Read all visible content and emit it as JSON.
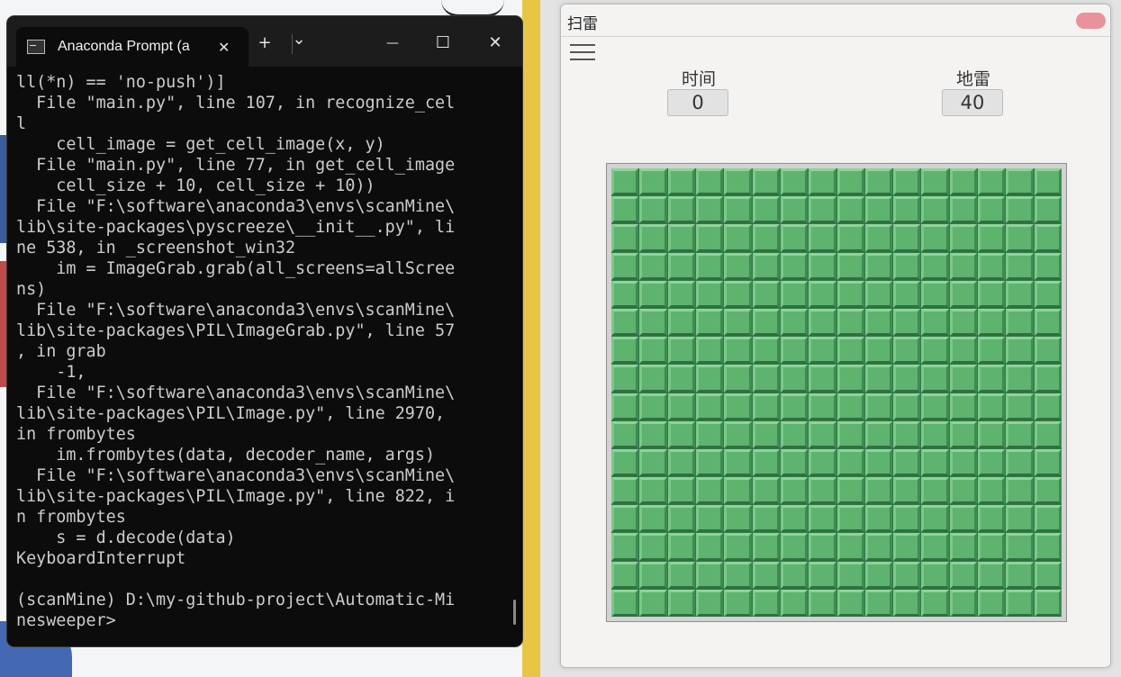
{
  "terminal": {
    "tab_title": "Anaconda Prompt (a",
    "lines": [
      "ll(*n) == 'no-push')]",
      "  File \"main.py\", line 107, in recognize_cel",
      "l",
      "    cell_image = get_cell_image(x, y)",
      "  File \"main.py\", line 77, in get_cell_image",
      "    cell_size + 10, cell_size + 10))",
      "  File \"F:\\software\\anaconda3\\envs\\scanMine\\",
      "lib\\site-packages\\pyscreeze\\__init__.py\", li",
      "ne 538, in _screenshot_win32",
      "    im = ImageGrab.grab(all_screens=allScree",
      "ns)",
      "  File \"F:\\software\\anaconda3\\envs\\scanMine\\",
      "lib\\site-packages\\PIL\\ImageGrab.py\", line 57",
      ", in grab",
      "    -1,",
      "  File \"F:\\software\\anaconda3\\envs\\scanMine\\",
      "lib\\site-packages\\PIL\\Image.py\", line 2970,",
      "in frombytes",
      "    im.frombytes(data, decoder_name, args)",
      "  File \"F:\\software\\anaconda3\\envs\\scanMine\\",
      "lib\\site-packages\\PIL\\Image.py\", line 822, i",
      "n frombytes",
      "    s = d.decode(data)",
      "KeyboardInterrupt",
      "",
      "(scanMine) D:\\my-github-project\\Automatic-Mi",
      "nesweeper>"
    ],
    "new_tab_glyph": "+",
    "dropdown_glyph": "⌄",
    "minimize_glyph": "—",
    "maximize_glyph": "☐",
    "close_glyph": "✕",
    "tab_close_glyph": "✕"
  },
  "minesweeper": {
    "title": "扫雷",
    "time_label": "时间",
    "time_value": "0",
    "mines_label": "地雷",
    "mines_value": "40",
    "rows": 16,
    "cols": 16
  }
}
